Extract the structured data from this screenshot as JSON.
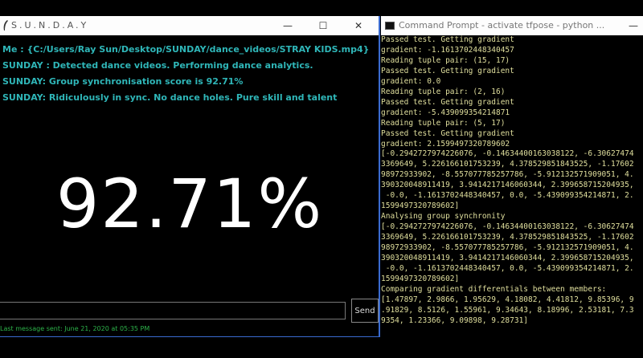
{
  "left_window": {
    "title": "S.U.N.D.A.Y",
    "minimize": "—",
    "maximize": "☐",
    "close": "✕",
    "messages": [
      "Me : {C:/Users/Ray Sun/Desktop/SUNDAY/dance_videos/STRAY KIDS.mp4}",
      "SUNDAY : Detected dance videos. Performing dance analytics.",
      "SUNDAY: Group synchronisation score is 92.71%",
      "SUNDAY: Ridiculously in sync. No dance holes. Pure skill and talent"
    ],
    "score": "92.71%",
    "input_value": "",
    "send_label": "Send",
    "last_message": "Last message sent: June 21, 2020 at 05:35 PM"
  },
  "right_window": {
    "title": "Command Prompt - activate  tfpose - python ...",
    "minimize": "—",
    "console_lines": [
      "Passed test. Getting gradient",
      "gradient: -1.1613702448340457",
      "Reading tuple pair: (15, 17)",
      "Passed test. Getting gradient",
      "gradient: 0.0",
      "Reading tuple pair: (2, 16)",
      "Passed test. Getting gradient",
      "gradient: -5.439099354214871",
      "Reading tuple pair: (5, 17)",
      "Passed test. Getting gradient",
      "gradient: 2.1599497320789602",
      "[-0.2942727974226076, -0.14634400163038122, -6.30627474",
      "3369649, 5.226166101753239, 4.378529851843525, -1.17602",
      "98972933902, -8.557077785257786, -5.912132571909051, 4.",
      "390320048911419, 3.9414217146060344, 2.399658715204935,",
      " -0.0, -1.1613702448340457, 0.0, -5.439099354214871, 2.",
      "1599497320789602]",
      "Analysing group synchronity",
      "[-0.2942727974226076, -0.14634400163038122, -6.30627474",
      "3369649, 5.226166101753239, 4.378529851843525, -1.17602",
      "98972933902, -8.557077785257786, -5.912132571909051, 4.",
      "390320048911419, 3.9414217146060344, 2.399658715204935,",
      " -0.0, -1.1613702448340457, 0.0, -5.439099354214871, 2.",
      "1599497320789602]",
      "Comparing gradient differentials between members:",
      "[1.47897, 2.9866, 1.95629, 4.18082, 4.41812, 9.85396, 9",
      ".91829, 8.5126, 1.55961, 9.34643, 8.18996, 2.53181, 7.3",
      "9354, 1.23366, 9.09898, 9.28731]"
    ]
  }
}
